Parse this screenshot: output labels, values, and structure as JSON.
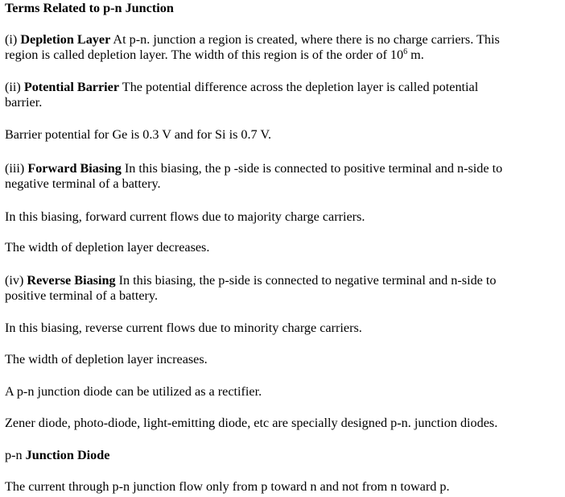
{
  "heading": "Terms Related to p-n Junction",
  "depletion": {
    "prefix": "(i) ",
    "term": "Depletion Layer",
    "line1": " At p-n. junction a region is created, where there is no charge carriers. This",
    "line2_a": "region is called depletion layer. The width of this region is of the order of 10",
    "exponent": "6",
    "line2_b": " m."
  },
  "barrier": {
    "prefix": "(ii) ",
    "term": "Potential Barrier",
    "line1": " The potential difference across the depletion layer is called potential",
    "line2": "barrier.",
    "values": "Barrier potential for Ge is 0.3 V and for Si is 0.7 V."
  },
  "forward": {
    "prefix": "(iii) ",
    "term": "Forward Biasing",
    "line1": " In this biasing, the p -side is connected to positive terminal and n-side to",
    "line2": "negative terminal of a battery.",
    "current": "In this biasing, forward current flows due to majority charge carriers.",
    "width": "The width of depletion layer decreases."
  },
  "reverse": {
    "prefix": "(iv) ",
    "term": "Reverse Biasing",
    "line1": " In this biasing, the p-side is connected to negative terminal and n-side to",
    "line2": "positive terminal of a battery.",
    "current": "In this biasing, reverse current flows due to minority charge carriers.",
    "width": "The width of depletion layer increases."
  },
  "rectifier": "A p-n junction diode can be utilized as a rectifier.",
  "special": "Zener diode, photo-diode, light-emitting diode, etc are specially designed p-n. junction diodes.",
  "diode_heading": {
    "prefix": "p-n ",
    "term": "Junction Diode"
  },
  "current_direction": "The current through p-n junction flow only from p toward n and not from n toward p."
}
